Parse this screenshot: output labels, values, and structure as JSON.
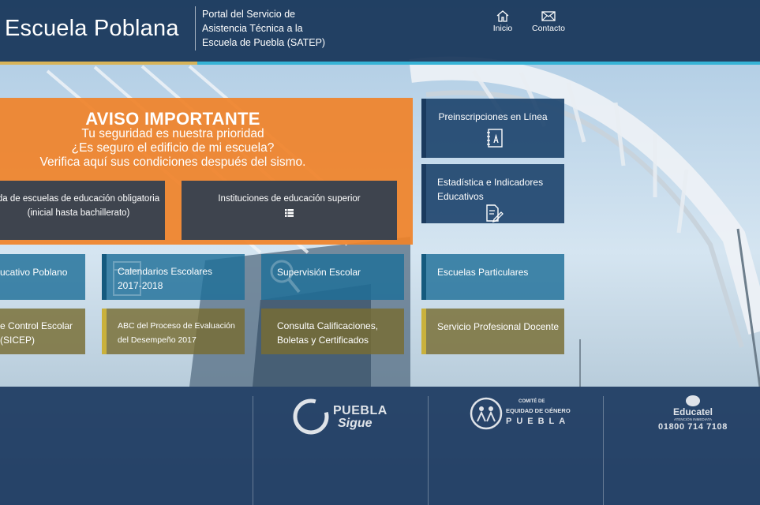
{
  "header": {
    "brand": "Escuela Poblana",
    "portal_line1": "Portal del Servicio de",
    "portal_line2": "Asistencia Técnica a la",
    "portal_line3": "Escuela de Puebla (SATEP)",
    "nav": [
      {
        "label": "Inicio",
        "icon": "home-icon"
      },
      {
        "label": "Contacto",
        "icon": "mail-icon"
      }
    ]
  },
  "aviso": {
    "title": "AVISO IMPORTANTE",
    "line1": "Tu seguridad es nuestra prioridad",
    "line2": "¿Es seguro el edificio de mi escuela?",
    "line3": "Verifica aquí sus condiciones después del sismo.",
    "btn_obligatoria_line1": "da de escuelas de educación obligatoria",
    "btn_obligatoria_line2": "(inicial hasta bachillerato)",
    "btn_superior": "Instituciones de educación superior"
  },
  "right_tiles": {
    "preinscripciones": "Preinscripciones en Línea",
    "estadistica_line1": "Estadística e Indicadores",
    "estadistica_line2": "Educativos"
  },
  "tiles": {
    "educativo": "ucativo Poblano",
    "calendarios_line1": "Calendarios Escolares",
    "calendarios_line2": "2017-2018",
    "supervision": "Supervisión Escolar",
    "particulares": "Escuelas Particulares",
    "control_line1": "e Control Escolar",
    "control_line2": "(SICEP)",
    "abc_line1": "ABC del Proceso de Evaluación",
    "abc_line2": "del Desempeño 2017",
    "consulta_line1": "Consulta Calificaciones,",
    "consulta_line2": "Boletas y Certificados",
    "servicio": "Servicio Profesional Docente"
  },
  "footer": {
    "puebla_sigue_1": "PUEBLA",
    "puebla_sigue_2": "Sigue",
    "comite_1": "COMITÉ DE",
    "comite_2": "EQUIDAD DE GÉNERO",
    "comite_3": "PUEBLA",
    "educatel": "Educatel",
    "educatel_sub": "ATENCIÓN INMEDIATA",
    "educatel_phone": "01800 714 7108"
  },
  "colors": {
    "header_bg": "#163458",
    "orange": "#f08228",
    "gold": "#d7b45a",
    "cyan": "#36b3d6",
    "tile_blue": "#1e6f98",
    "tile_olive": "#786c32",
    "tile_dark": "#2f3e50"
  }
}
